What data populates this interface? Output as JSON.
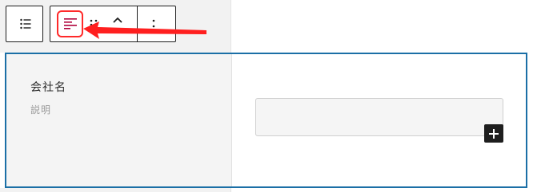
{
  "toolbar": {
    "list_view_icon": "list-view-icon",
    "text_align_icon": "text-align-icon",
    "drag_icon": "drag-handle-icon",
    "move_up_icon": "chevron-up-icon",
    "more_icon": "more-vertical-icon"
  },
  "annotation": {
    "arrow_color": "#ff1f1f",
    "highlight_color": "#ff2a2a"
  },
  "field_block": {
    "label": "会社名",
    "description": "説明",
    "input_value": "",
    "add_icon": "plus-icon",
    "selected_border_color": "#1b6fa6"
  }
}
